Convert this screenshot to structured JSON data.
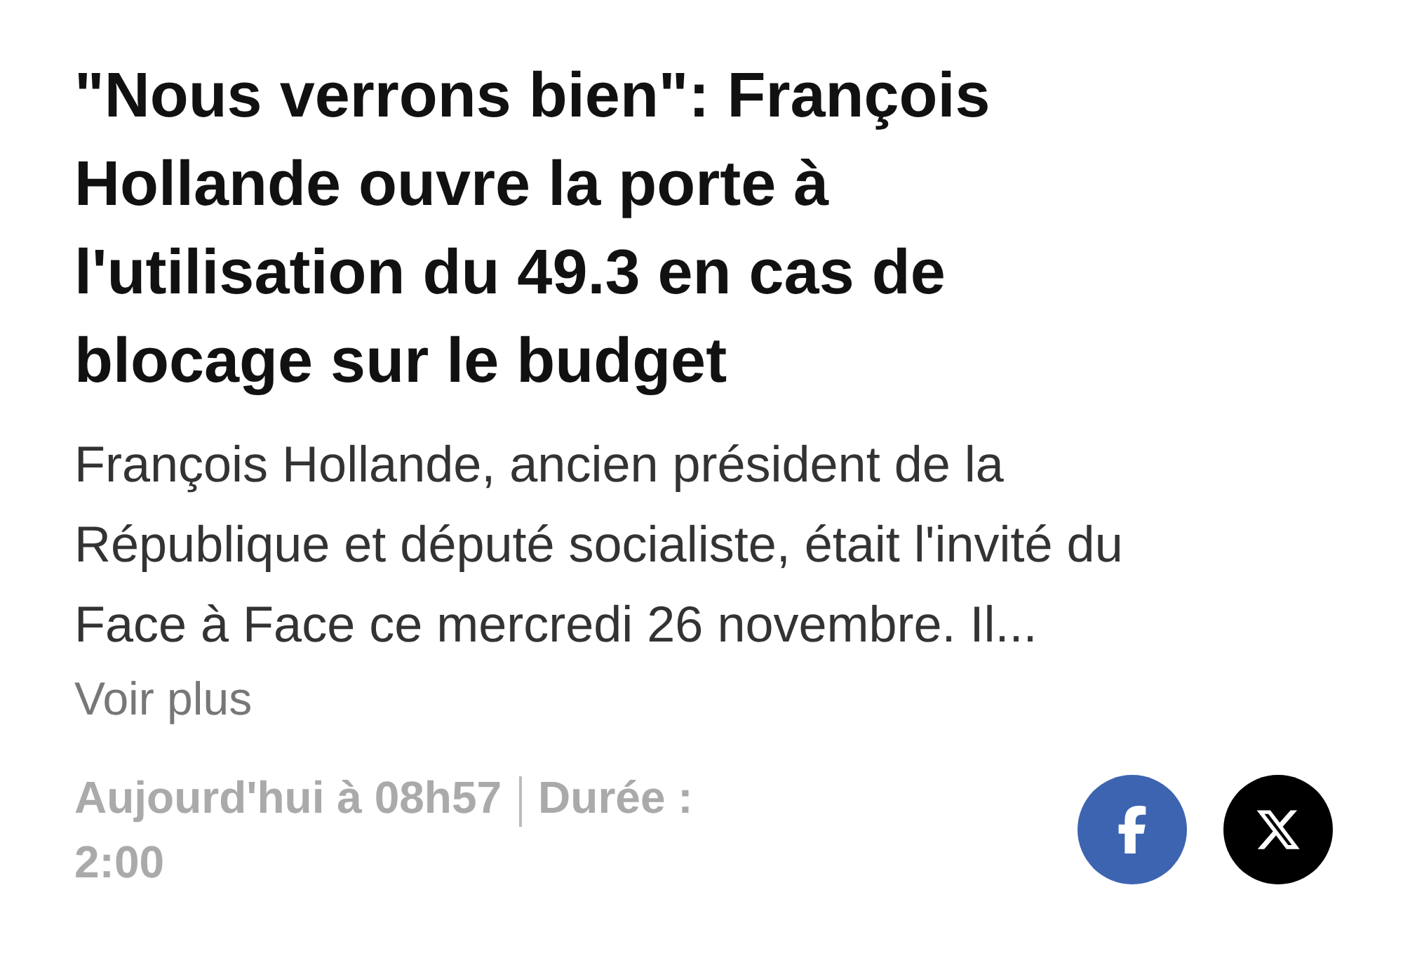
{
  "headline": "\"Nous verrons bien\": François Hollande ouvre la porte à l'utilisation du 49.3 en cas de blocage sur le budget",
  "summary": "François Hollande, ancien président de la République et député socialiste, était l'invité du Face à Face ce mercredi 26 novembre. Il...",
  "more_link": "Voir plus",
  "meta": {
    "date": "Aujourd'hui à 08h57",
    "duration_label": "Durée :",
    "duration": "2:00"
  },
  "share_buttons": [
    {
      "kind": "facebook"
    },
    {
      "kind": "x"
    }
  ]
}
